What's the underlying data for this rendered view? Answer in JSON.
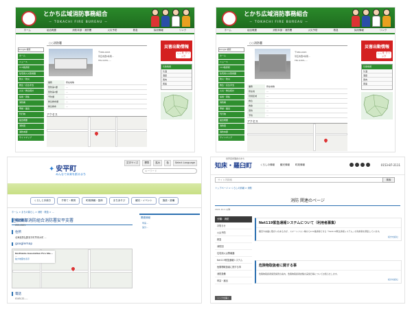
{
  "tokachi_panel_1": {
    "title": "とかち広域消防事務組合",
    "subtitle": "－ TOKACHI FIRE BUREAU －",
    "nav": [
      "ホーム",
      "組合概要",
      "消防本部・消防署",
      "火災予防",
      "救急",
      "採用情報",
      "リンク",
      "サイトマップ"
    ],
    "search_placeholder": "Google 検索",
    "sidebar": [
      "ホーム",
      "ニュース",
      "119番通報",
      "住宅用火災警報器",
      "防火・防災",
      "救急・応急手当",
      "火災・救急統計",
      "採用・募集",
      "消防署",
      "申請・届出",
      "刊行物",
      "組合概要",
      "消防団",
      "消防本部",
      "サイトマップ"
    ],
    "page_title": "○○消防署",
    "address_lines": [
      "〒080-0015",
      "帯広市西5条南...",
      "TEL 0155-...."
    ],
    "table_header": [
      "業務",
      "所在地等"
    ],
    "table": [
      [
        "警防第1課",
        "..."
      ],
      [
        "警防第2課",
        "..."
      ],
      [
        "予防課",
        "..."
      ],
      [
        "救急救命課",
        "..."
      ],
      [
        "救急救命",
        "..."
      ]
    ],
    "alert_title": "災害出動情報",
    "alert_button": "ここを\nクリック",
    "weather_title": "気象情報",
    "weather_rows": [
      "気温",
      "湿度",
      "風向",
      "風速",
      "降水量"
    ],
    "access_label": "アクセス"
  },
  "tokachi_panel_2": {
    "page_title": "○○消防署",
    "address_lines": [
      "〒080-0015",
      "帯広市西5条南...",
      "TEL 0155-...."
    ],
    "table": [
      [
        "所在地",
        "..."
      ],
      [
        "管轄区域",
        "..."
      ],
      [
        "救急",
        "..."
      ],
      [
        "救助",
        "..."
      ],
      [
        "警防",
        "..."
      ],
      [
        "予防",
        "..."
      ],
      [
        "消防",
        "..."
      ],
      [
        "その他",
        "..."
      ]
    ],
    "access_label": "アクセス"
  },
  "bottom_left": {
    "logo": "安平町",
    "tagline": "みんなで未来を創るまち",
    "tools": [
      "文字サイズ",
      "標準",
      "拡大",
      "色",
      "Select Language"
    ],
    "search_placeholder": "キーワード",
    "nav": [
      "くらしと手続き",
      "子育て・教育",
      "町政情報・団体",
      "まちあそび",
      "観光・イベント",
      "施設・設備",
      "事業者の方へ",
      "地域情報"
    ],
    "breadcrumb": "ホーム > まちの暮らし > 消防・救急 > ...",
    "page_title": "胆振東部消防組合消防署安平支署",
    "sections": [
      {
        "heading": "郵便番号",
        "text": "059-1501"
      },
      {
        "heading": "住所",
        "text": "北海道勇払郡安平町早来大町 ..."
      },
      {
        "heading": "googlemap",
        "text": ""
      },
      {
        "heading": "電話",
        "text": "0145-22-...."
      }
    ],
    "map_card": [
      "Northside Association Fire Sta...",
      "...",
      "拡大地図を表示"
    ],
    "right_heading": "関連情報",
    "right_links": [
      "早来...",
      "追分..."
    ]
  },
  "bottom_right": {
    "logo": "知床・羅臼町",
    "logo_small": "世界自然遺産のまち",
    "links": [
      "くらしの情報",
      "観光情報",
      "町政情報"
    ],
    "tel": "0153-87-2111",
    "search_placeholder": "サイト内検索",
    "search_button": "検索",
    "breadcrumb": "トップページ > くらしの情報 > 消防",
    "page_title": "消防 関連のページ",
    "date": "2021.10.1 以降",
    "side_heading": "分類：消防",
    "side_items": [
      "お知らせ",
      "火災予防",
      "救急",
      "消防団",
      "住宅用火災警報器",
      "Net119緊急通報システム",
      "危険物取扱者に関する事",
      "消防設備",
      "申請・届出"
    ],
    "cards": [
      {
        "title": "Net119緊急通報システムについて（利用者募集）",
        "desc": "聴覚や言語に障がいのある方が、スマートフォン等から119番通報できる「Net119緊急通報システム」の利用者を募集しています。",
        "more": "続きを読む"
      },
      {
        "title": "危険物取扱者に関する事",
        "desc": "危険物取扱者保安講習の案内、危険物取扱者試験の実施日等についてお知らせします。",
        "more": "続きを読む"
      }
    ],
    "tooltip": "リンクを開く"
  }
}
